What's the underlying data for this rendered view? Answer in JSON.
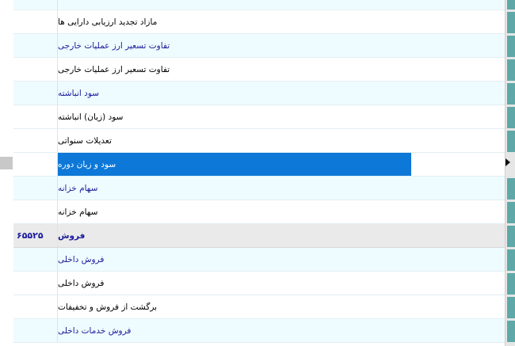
{
  "rows": [
    {
      "kind": "data",
      "title": "مازاد تجدید ارزیابی دارایی ها",
      "amount": "",
      "code": ""
    },
    {
      "kind": "header",
      "title": "تفاوت تسعیر ارز عملیات خارجی",
      "amount": "",
      "code": ""
    },
    {
      "kind": "data",
      "title": "تفاوت تسعیر ارز عملیات خارجی",
      "amount": "",
      "code": ""
    },
    {
      "kind": "header",
      "title": "سود انباشته",
      "amount": "",
      "code": ""
    },
    {
      "kind": "data",
      "title": "سود (زیان) انباشته",
      "amount": "",
      "code": ""
    },
    {
      "kind": "data",
      "title": "تعدیلات سنواتی",
      "amount": "",
      "code": ""
    },
    {
      "kind": "selected",
      "title": "سود و زیان دوره",
      "amount": "",
      "code": ""
    },
    {
      "kind": "header",
      "title": "سهام خزانه",
      "amount": "",
      "code": ""
    },
    {
      "kind": "data",
      "title": "سهام خزانه",
      "amount": "",
      "code": ""
    },
    {
      "kind": "total",
      "title": "فروش",
      "amount": "۶۵۵۲۵",
      "code": ""
    },
    {
      "kind": "header",
      "title": "فروش داخلی",
      "amount": "",
      "code": ""
    },
    {
      "kind": "data",
      "title": "فروش داخلی",
      "amount": "",
      "code": ""
    },
    {
      "kind": "data",
      "title": "برگشت از فروش و تخفیفات",
      "amount": "",
      "code": ""
    },
    {
      "kind": "header",
      "title": "فروش خدمات داخلی",
      "amount": "",
      "code": ""
    }
  ]
}
